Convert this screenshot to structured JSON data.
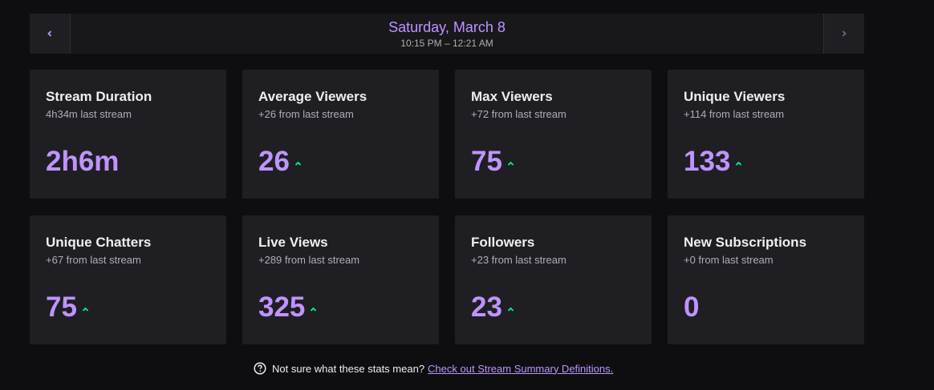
{
  "header": {
    "date": "Saturday, March 8",
    "time_range": "10:15 PM – 12:21 AM"
  },
  "icons": {
    "prev": "chevron-left-icon",
    "next": "chevron-right-icon",
    "trend": "caret-up-icon",
    "help": "question-circle-icon"
  },
  "colors": {
    "accent": "#bf94ff",
    "trend_up": "#00f593",
    "card_bg": "#1f1f23",
    "page_bg": "#0e0e10"
  },
  "stats": [
    {
      "title": "Stream Duration",
      "sub": "4h34m last stream",
      "value": "2h6m",
      "trend": "none"
    },
    {
      "title": "Average Viewers",
      "sub": "+26 from last stream",
      "value": "26",
      "trend": "up"
    },
    {
      "title": "Max Viewers",
      "sub": "+72 from last stream",
      "value": "75",
      "trend": "up"
    },
    {
      "title": "Unique Viewers",
      "sub": "+114 from last stream",
      "value": "133",
      "trend": "up"
    },
    {
      "title": "Unique Chatters",
      "sub": "+67 from last stream",
      "value": "75",
      "trend": "up"
    },
    {
      "title": "Live Views",
      "sub": "+289 from last stream",
      "value": "325",
      "trend": "up"
    },
    {
      "title": "Followers",
      "sub": "+23 from last stream",
      "value": "23",
      "trend": "up"
    },
    {
      "title": "New Subscriptions",
      "sub": "+0 from last stream",
      "value": "0",
      "trend": "none"
    }
  ],
  "footer": {
    "text": "Not sure what these stats mean?",
    "link": "Check out Stream Summary Definitions."
  }
}
